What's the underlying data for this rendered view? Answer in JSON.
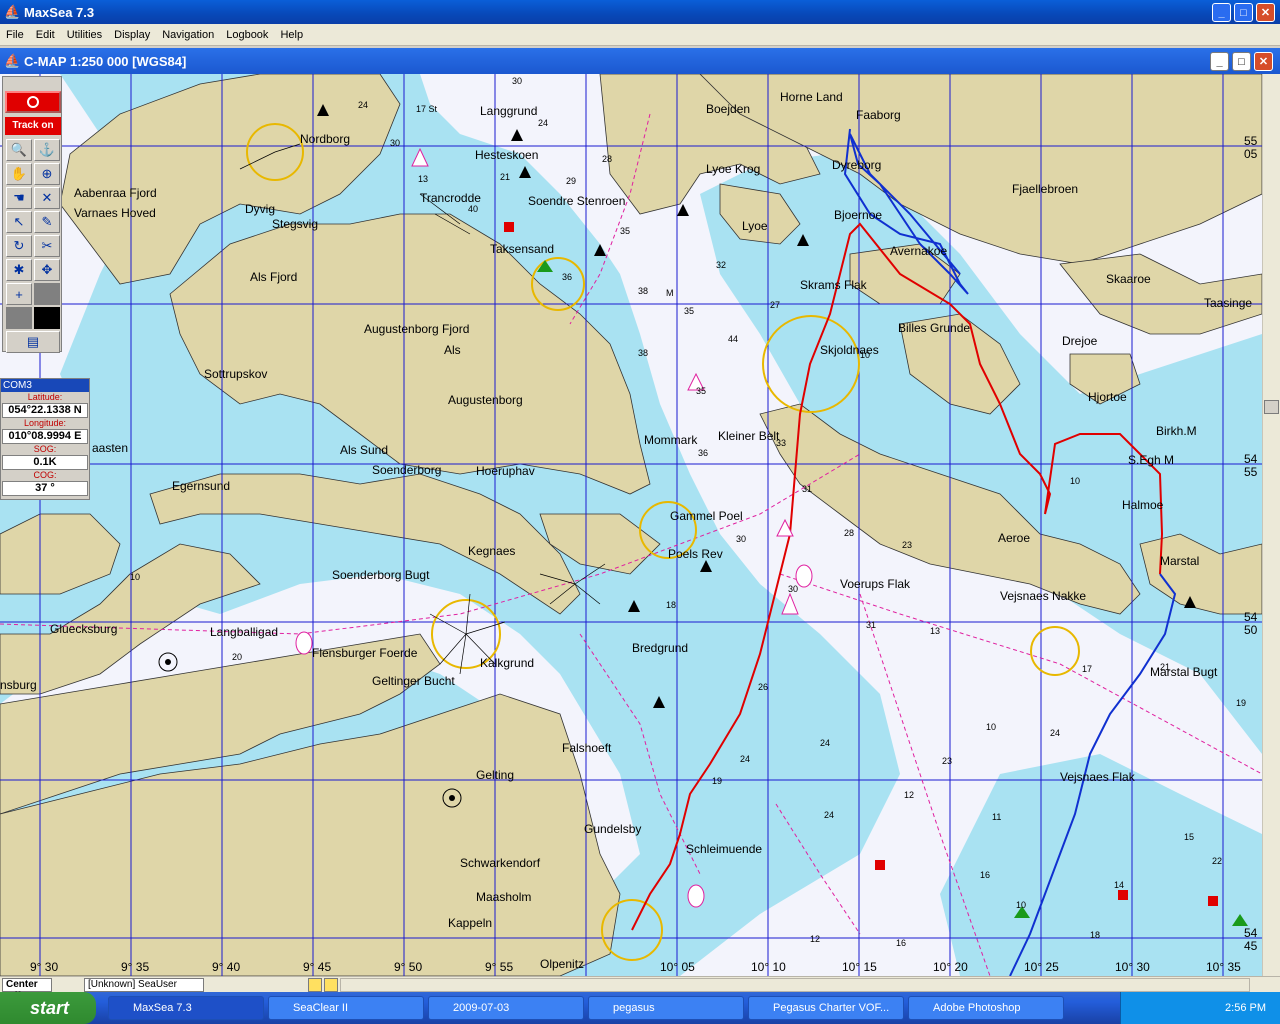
{
  "app": {
    "title": "MaxSea 7.3"
  },
  "menu": [
    "File",
    "Edit",
    "Utilities",
    "Display",
    "Navigation",
    "Logbook",
    "Help"
  ],
  "chart_window": {
    "title": "C-MAP  1:250 000 [WGS84]"
  },
  "toolbar": {
    "track_label": "Track on"
  },
  "com_panel": {
    "title": "COM3",
    "latitude_label": "Latitude:",
    "latitude": "054°22.1338 N",
    "longitude_label": "Longitude:",
    "longitude": "010°08.9994 E",
    "sog_label": "SOG:",
    "sog": "0.1K",
    "cog_label": "COG:",
    "cog": "37 °"
  },
  "place_names": [
    "Horne Land",
    "Faaborg",
    "Boejden",
    "Langgrund",
    "Nordborg",
    "Hesteskoen",
    "Lyoe Krog",
    "Dyreborg",
    "Fjaellebroen",
    "Aabenraa Fjord",
    "Varnaes Hoved",
    "Dyvig",
    "Stegsvig",
    "Trancrodde",
    "Soendre Stenroen",
    "Lyoe",
    "Bjoernoe",
    "Taksensand",
    "Avernakoe",
    "Skaaroe",
    "Taasinge",
    "Als Fjord",
    "Skrams Flak",
    "Billes Grunde",
    "Drejoe",
    "Augustenborg Fjord",
    "Als",
    "Skjoldnaes",
    "Hjortoe",
    "Sottrupskov",
    "Augustenborg",
    "Kleiner Belt",
    "Mommark",
    "Birkh.M",
    "S.Egh M",
    "aasten",
    "Als Sund",
    "Soenderborg",
    "Hoeruphav",
    "Egernsund",
    "Halmoe",
    "Gammel Poel",
    "Kegnaes",
    "Poels Rev",
    "Aeroe",
    "Marstal",
    "Soenderborg Bugt",
    "Voerups Flak",
    "Vejsnaes Nakke",
    "Gluecksburg",
    "Langballigad",
    "Flensburger Foerde",
    "Kalkgrund",
    "Bredgrund",
    "Marstal Bugt",
    "nsburg",
    "Geltinger Bucht",
    "Falshoeft",
    "Gelting",
    "Vejsnaes Flak",
    "Gundelsby",
    "Schleimuende",
    "Schwarkendorf",
    "Maasholm",
    "Kappeln",
    "Olpenitz"
  ],
  "lat_labels": [
    "55",
    "05",
    "54",
    "55",
    "54",
    "50",
    "54",
    "45"
  ],
  "lon_labels": [
    "9° 30",
    "9° 35",
    "9° 40",
    "9° 45",
    "9° 50",
    "9° 55",
    "10° 05",
    "10° 10",
    "10° 15",
    "10° 20",
    "10° 25",
    "10° 30",
    "10° 35"
  ],
  "depths": [
    "30",
    "24",
    "17 St",
    "24",
    "30",
    "28",
    "21",
    "29",
    "40",
    "35",
    "36",
    "32",
    "38",
    "M",
    "35",
    "27",
    "44",
    "38",
    "35",
    "33",
    "36",
    "31",
    "30",
    "28",
    "23",
    "18",
    "30",
    "31",
    "13",
    "17",
    "24",
    "26",
    "24",
    "23",
    "24",
    "19",
    "24",
    "12",
    "11",
    "21",
    "19",
    "15",
    "22",
    "18",
    "16",
    "12",
    "16",
    "14",
    "10",
    "10",
    "20",
    "10",
    "10",
    "10",
    "13"
  ],
  "statusbar": {
    "center": "Center Off",
    "unknown": "[Unknown] SeaUser"
  },
  "taskbar": {
    "start": "start",
    "tasks": [
      "MaxSea 7.3",
      "SeaClear II",
      "2009-07-03",
      "pegasus",
      "Pegasus Charter VOF...",
      "Adobe Photoshop"
    ],
    "clock": "2:56 PM"
  },
  "colors": {
    "land": "#dfd6a8",
    "shallow": "#a9e2f2",
    "deep": "#f3f4fc",
    "grid": "#1a1ad0",
    "track_red": "#e00000",
    "track_blue": "#1030d0"
  }
}
